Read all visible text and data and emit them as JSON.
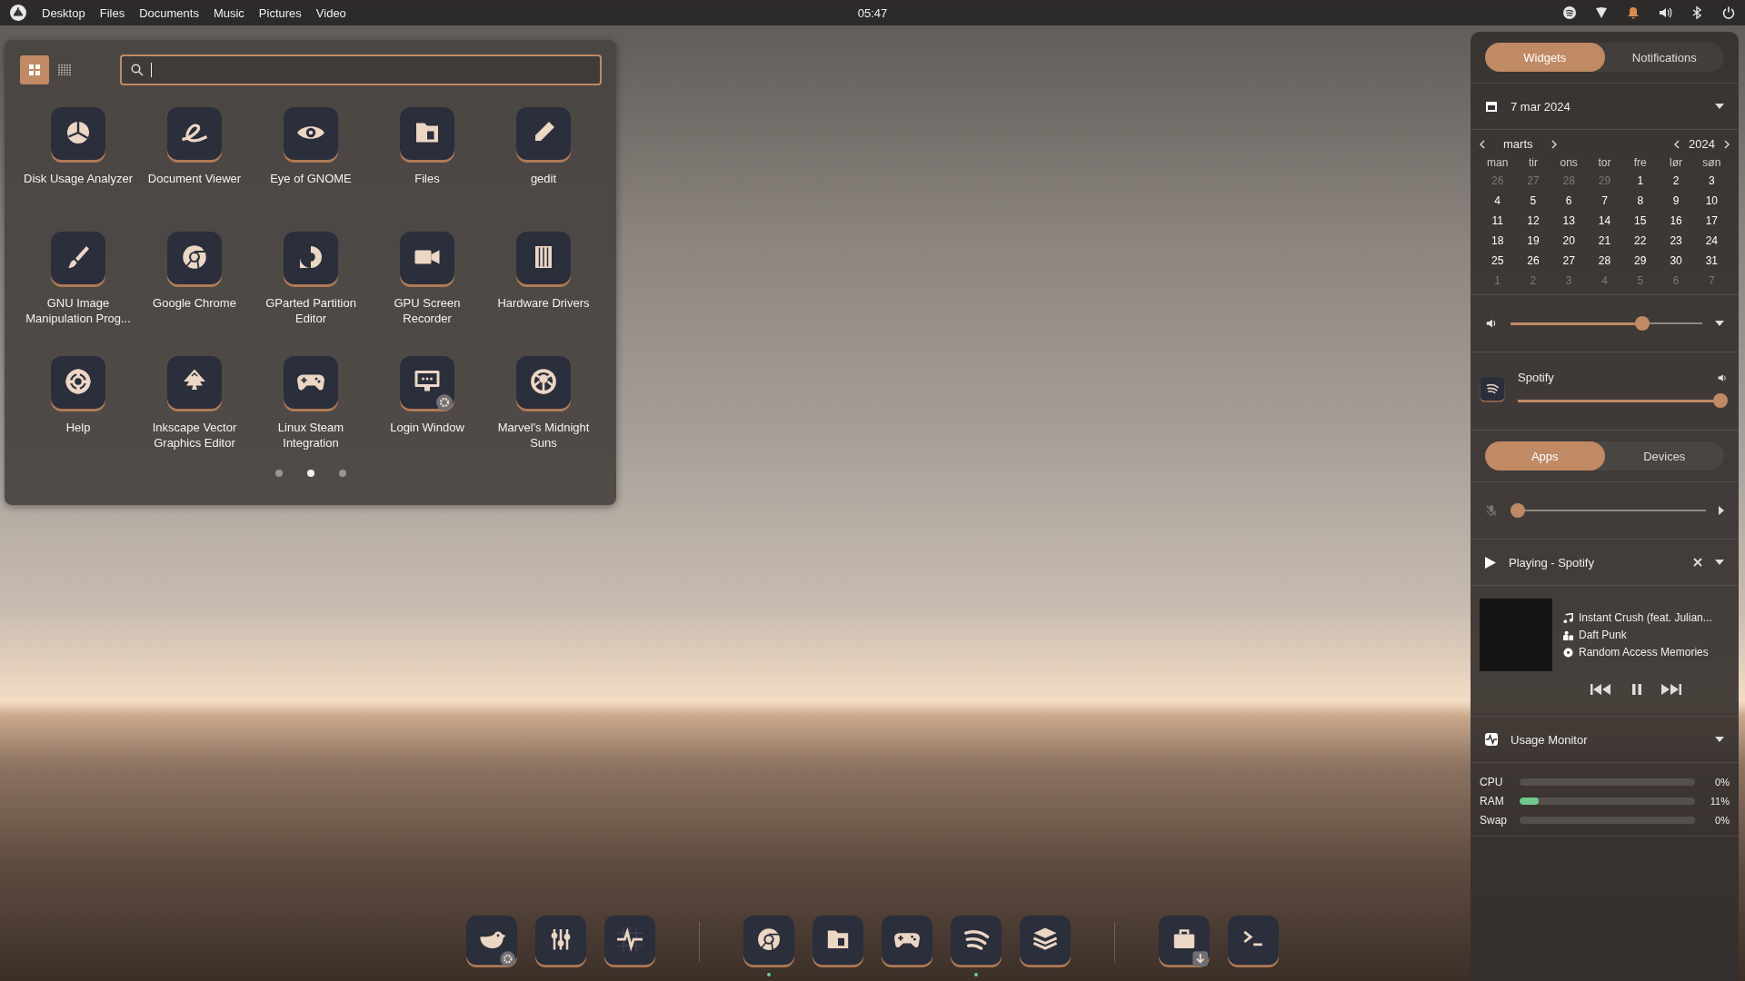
{
  "top_bar": {
    "menu": [
      "Desktop",
      "Files",
      "Documents",
      "Music",
      "Pictures",
      "Video"
    ],
    "clock": "05:47",
    "notification_pending": true
  },
  "launcher": {
    "view_buttons": [
      {
        "kind": "grid",
        "selected": true
      },
      {
        "kind": "list",
        "selected": false
      }
    ],
    "search": {
      "focused": true
    },
    "apps": [
      {
        "name": "Disk Usage Analyzer",
        "badge": false
      },
      {
        "name": "Document Viewer",
        "badge": false
      },
      {
        "name": "Eye of GNOME",
        "badge": false
      },
      {
        "name": "Files",
        "badge": false
      },
      {
        "name": "gedit",
        "badge": false
      },
      {
        "name": "GNU Image Manipulation Prog...",
        "badge": false
      },
      {
        "name": "Google Chrome",
        "badge": false
      },
      {
        "name": "GParted Partition Editor",
        "badge": false
      },
      {
        "name": "GPU Screen Recorder",
        "badge": false
      },
      {
        "name": "Hardware Drivers",
        "badge": false
      },
      {
        "name": "Help",
        "badge": false
      },
      {
        "name": "Inkscape Vector Graphics Editor",
        "badge": false
      },
      {
        "name": "Linux Steam Integration",
        "badge": false
      },
      {
        "name": "Login Window",
        "badge": true
      },
      {
        "name": "Marvel's Midnight Suns",
        "badge": false
      }
    ],
    "pages": [
      {
        "selected": false
      },
      {
        "selected": true
      },
      {
        "selected": false
      }
    ]
  },
  "panel": {
    "tabs": [
      {
        "label": "Widgets",
        "selected": true
      },
      {
        "label": "Notifications",
        "selected": false
      }
    ],
    "calendar": {
      "date": "7 mar 2024",
      "month": "marts",
      "year": "2024",
      "weekdays": [
        "man",
        "tir",
        "ons",
        "tor",
        "fre",
        "lør",
        "søn"
      ],
      "days": [
        {
          "n": "26",
          "outside": true
        },
        {
          "n": "27",
          "outside": true
        },
        {
          "n": "28",
          "outside": true
        },
        {
          "n": "29",
          "outside": true
        },
        {
          "n": "1",
          "outside": false
        },
        {
          "n": "2",
          "outside": false
        },
        {
          "n": "3",
          "outside": false
        },
        {
          "n": "4",
          "outside": false
        },
        {
          "n": "5",
          "outside": false
        },
        {
          "n": "6",
          "outside": false
        },
        {
          "n": "7",
          "outside": false
        },
        {
          "n": "8",
          "outside": false
        },
        {
          "n": "9",
          "outside": false
        },
        {
          "n": "10",
          "outside": false
        },
        {
          "n": "11",
          "outside": false
        },
        {
          "n": "12",
          "outside": false
        },
        {
          "n": "13",
          "outside": false
        },
        {
          "n": "14",
          "outside": false
        },
        {
          "n": "15",
          "outside": false
        },
        {
          "n": "16",
          "outside": false
        },
        {
          "n": "17",
          "outside": false
        },
        {
          "n": "18",
          "outside": false
        },
        {
          "n": "19",
          "outside": false
        },
        {
          "n": "20",
          "outside": false
        },
        {
          "n": "21",
          "outside": false
        },
        {
          "n": "22",
          "outside": false
        },
        {
          "n": "23",
          "outside": false
        },
        {
          "n": "24",
          "outside": false
        },
        {
          "n": "25",
          "outside": false
        },
        {
          "n": "26",
          "outside": false
        },
        {
          "n": "27",
          "outside": false
        },
        {
          "n": "28",
          "outside": false
        },
        {
          "n": "29",
          "outside": false
        },
        {
          "n": "30",
          "outside": false
        },
        {
          "n": "31",
          "outside": false
        },
        {
          "n": "1",
          "outside": true
        },
        {
          "n": "2",
          "outside": true
        },
        {
          "n": "3",
          "outside": true
        },
        {
          "n": "4",
          "outside": true
        },
        {
          "n": "5",
          "outside": true
        },
        {
          "n": "6",
          "outside": true
        },
        {
          "n": "7",
          "outside": true
        }
      ]
    },
    "volume": {
      "level": 0.7
    },
    "app_volume": {
      "name": "Spotify",
      "level": 1
    },
    "mixer_tabs": [
      {
        "label": "Apps",
        "selected": true
      },
      {
        "label": "Devices",
        "selected": false
      }
    ],
    "microphone": {
      "muted": true,
      "level": 0
    },
    "player": {
      "status": "Playing - Spotify",
      "playing": true,
      "title": "Instant Crush (feat. Julian...",
      "artist": "Daft Punk",
      "album": "Random Access Memories"
    },
    "usage": {
      "title": "Usage Monitor",
      "meters": [
        {
          "name": "CPU",
          "level": 0,
          "reading": "0%"
        },
        {
          "name": "RAM",
          "level": 0.11,
          "reading": "11%"
        },
        {
          "name": "Swap",
          "level": 0,
          "reading": "0%"
        }
      ]
    }
  },
  "dock": {
    "groups": [
      [
        {
          "running": false
        },
        {
          "running": false
        },
        {
          "running": false
        }
      ],
      [
        {
          "running": true
        },
        {
          "running": false
        },
        {
          "running": false
        },
        {
          "running": true
        },
        {
          "running": false
        }
      ],
      [
        {
          "running": false
        },
        {
          "running": false
        }
      ]
    ]
  }
}
